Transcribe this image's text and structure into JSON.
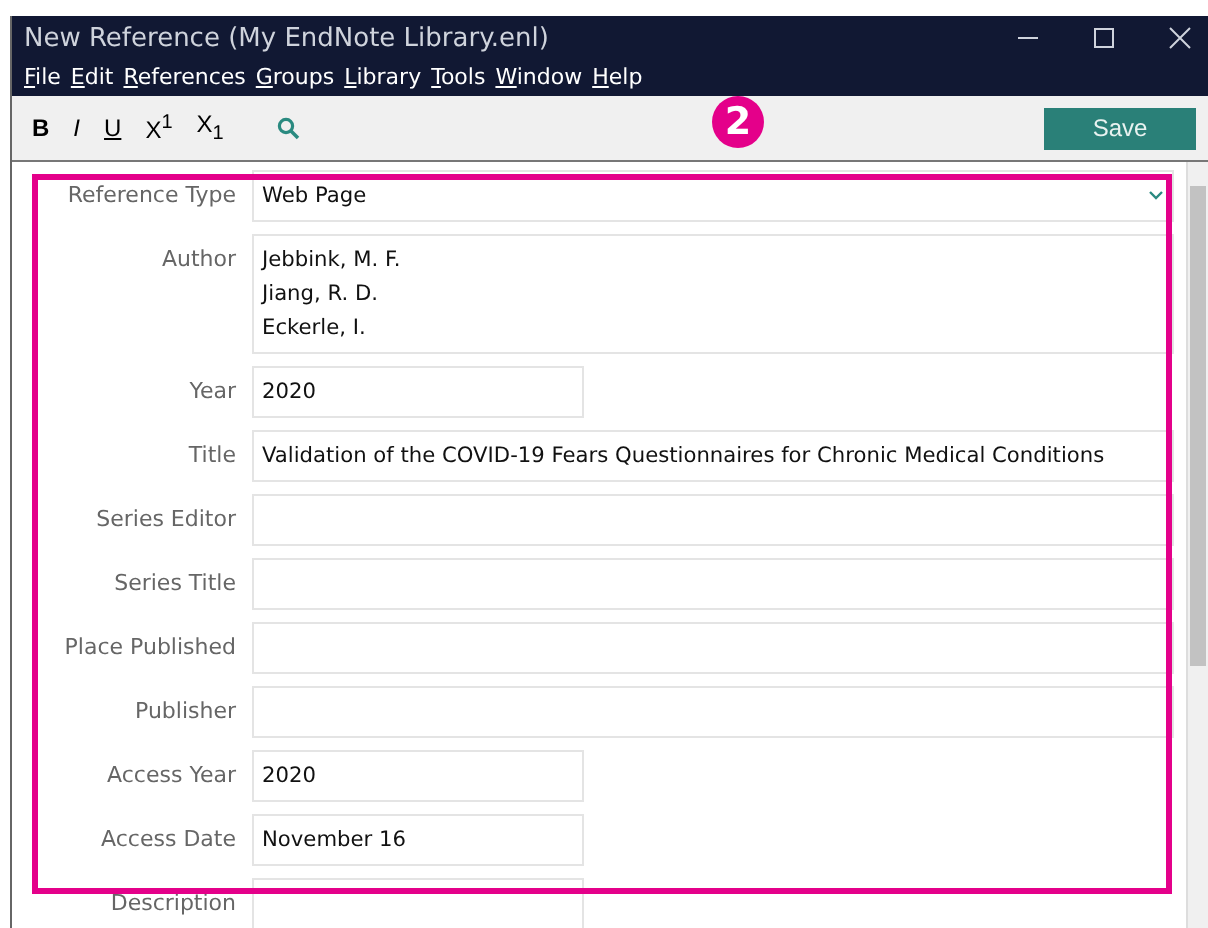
{
  "window": {
    "title": "New Reference (My EndNote Library.enl)"
  },
  "menu": [
    "File",
    "Edit",
    "References",
    "Groups",
    "Library",
    "Tools",
    "Window",
    "Help"
  ],
  "toolbar": {
    "format_buttons": [
      {
        "label": "B",
        "kind": "bold"
      },
      {
        "label": "I",
        "kind": "italic"
      },
      {
        "label": "U",
        "kind": "underline"
      },
      {
        "label": "X$^{1}$",
        "kind": "plain"
      },
      {
        "label": "X$_{1}$",
        "kind": "plain"
      }
    ],
    "save_button": "Save"
  },
  "callout": {
    "label": "2"
  },
  "fields": [
    {
      "label": "Reference Type",
      "kind": "dropdown",
      "value": "Web Page"
    },
    {
      "label": "Author",
      "kind": "multiline",
      "lines": [
        "Jebbink, M. F.",
        "Jiang, R. D.",
        "Eckerle, I."
      ]
    },
    {
      "label": "Year",
      "kind": "short",
      "value": "2020"
    },
    {
      "label": "Title",
      "kind": "wide",
      "value": "Validation of the COVID-19 Fears Questionnaires for Chronic Medical Conditions"
    },
    {
      "label": "Series Editor",
      "kind": "wide"
    },
    {
      "label": "Series Title",
      "kind": "wide"
    },
    {
      "label": "Place Published",
      "kind": "wide"
    },
    {
      "label": "Publisher",
      "kind": "wide"
    },
    {
      "label": "Access Year",
      "kind": "short",
      "value": "2020"
    },
    {
      "label": "Access Date",
      "kind": "short",
      "value": "November 16"
    },
    {
      "label": "Description",
      "kind": "short"
    }
  ]
}
